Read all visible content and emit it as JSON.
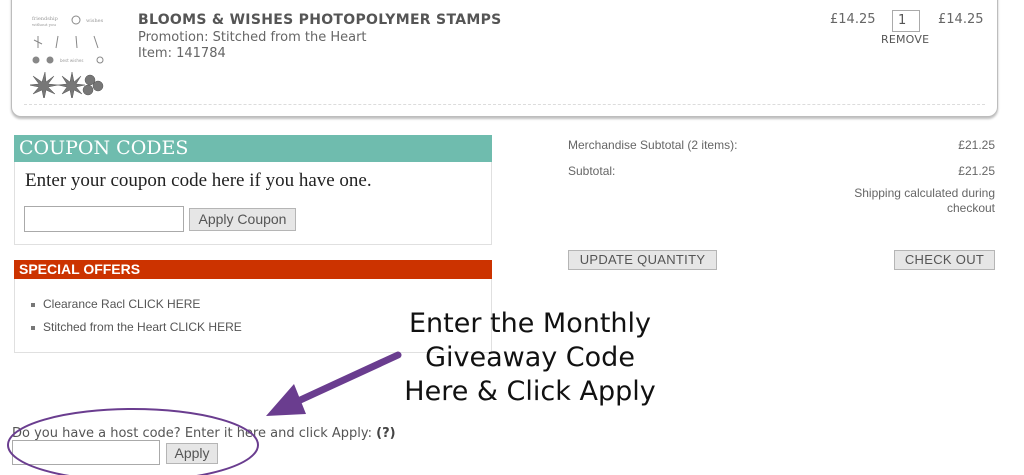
{
  "cart_item": {
    "title": "BLOOMS & WISHES PHOTOPOLYMER STAMPS",
    "promotion": "Promotion: Stitched from the Heart",
    "item_number": "Item: 141784",
    "unit_price": "£14.25",
    "quantity": "1",
    "line_total": "£14.25",
    "remove_label": "REMOVE"
  },
  "coupon": {
    "heading": "COUPON CODES",
    "description": "Enter your coupon code here if you have one.",
    "input_value": "",
    "apply_label": "Apply Coupon"
  },
  "special_offers": {
    "heading": "SPECIAL OFFERS",
    "items": [
      "Clearance Racl CLICK HERE",
      "Stitched from the Heart CLICK HERE"
    ]
  },
  "summary": {
    "merch_label": "Merchandise Subtotal (2 items):",
    "merch_value": "£21.25",
    "subtotal_label": "Subtotal:",
    "subtotal_value": "£21.25",
    "shipping_note": "Shipping calculated during checkout",
    "update_label": "UPDATE QUANTITY",
    "checkout_label": "CHECK OUT"
  },
  "annotation": {
    "lines": [
      "Enter the Monthly",
      "Giveaway Code",
      "Here & Click Apply"
    ]
  },
  "host_code": {
    "label": "Do you have a host code? Enter it here and click Apply:",
    "help": "(?)",
    "input_value": "",
    "apply_label": "Apply"
  },
  "colors": {
    "coupon_header": "#6fbcae",
    "offers_header": "#cc3300",
    "annotation_purple": "#6a3d8f"
  },
  "icons": [
    "stamp-sheet-thumbnail",
    "arrow-annotation",
    "circle-annotation"
  ]
}
